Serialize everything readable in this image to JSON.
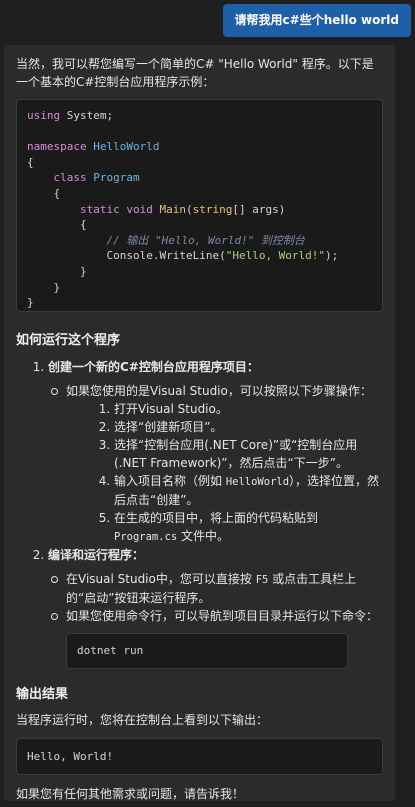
{
  "user_message": "请帮我用c#些个hello world",
  "answer": {
    "intro": "当然，我可以帮您编写一个简单的C# \"Hello World\" 程序。以下是一个基本的C#控制台应用程序示例：",
    "code": {
      "using": "using",
      "system": " System;",
      "namespace_kw": "namespace",
      "namespace_name": "HelloWorld",
      "brace_open": "{",
      "brace_close": "}",
      "class_kw": "class",
      "class_name": "Program",
      "static_kw": "static",
      "void_kw": "void",
      "main_fn": "Main",
      "string_kw": "string",
      "main_args": "[] args)",
      "comment": "// 输出 \"Hello, World!\" 到控制台",
      "console_call": "Console.WriteLine(",
      "hello_str": "\"Hello, World!\"",
      "call_end": ");"
    },
    "how_to_run_heading": "如何运行这个程序",
    "step1": {
      "title": "创建一个新的C#控制台应用程序项目：",
      "vs_intro": "如果您使用的是Visual Studio，可以按照以下步骤操作：",
      "items": [
        "打开Visual Studio。",
        "选择“创建新项目”。",
        "选择“控制台应用(.NET Core)”或“控制台应用(.NET Framework)”，然后点击“下一步”。",
        "输入项目名称（例如 HelloWorld），选择位置，然后点击“创建”。",
        "在生成的项目中，将上面的代码粘贴到 Program.cs 文件中。"
      ],
      "item4_pre": "输入项目名称（例如 ",
      "item4_code": "HelloWorld",
      "item4_post": "），选择位置，然后点击“创建”。",
      "item5_pre": "在生成的项目中，将上面的代码粘贴到 ",
      "item5_code": "Program.cs",
      "item5_post": " 文件中。"
    },
    "step2": {
      "title": "编译和运行程序：",
      "vs_pre": "在Visual Studio中，您可以直接按 ",
      "vs_key": "F5",
      "vs_post": " 或点击工具栏上的“启动”按钮来运行程序。",
      "cmd_text": "如果您使用命令行，可以导航到项目目录并运行以下命令：",
      "command": "dotnet run"
    },
    "output_heading": "输出结果",
    "output_intro": "当程序运行时，您将在控制台上看到以下输出：",
    "output_text": "Hello, World!",
    "closing": "如果您有任何其他需求或问题，请告诉我！"
  }
}
